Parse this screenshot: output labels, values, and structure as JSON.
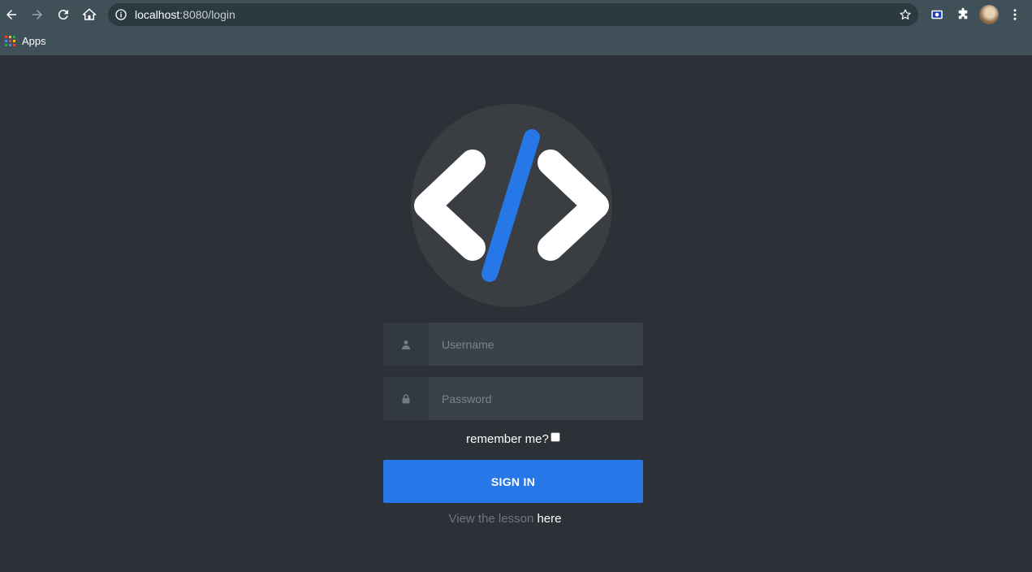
{
  "browser": {
    "url_host": "localhost",
    "url_rest": ":8080/login",
    "bookmarks": {
      "apps_label": "Apps"
    }
  },
  "login": {
    "username_placeholder": "Username",
    "password_placeholder": "Password",
    "remember_label": "remember me?",
    "signin_label": "SIGN IN",
    "lesson_text": "View the lesson",
    "lesson_link": "here"
  },
  "colors": {
    "page_bg": "#2c3138",
    "accent": "#2677e7",
    "chrome_bg": "#3f5059"
  },
  "icons": [
    "back-icon",
    "forward-icon",
    "reload-icon",
    "home-icon",
    "info-icon",
    "star-icon",
    "extension-icon",
    "puzzle-icon",
    "menu-icon",
    "user-icon",
    "lock-icon",
    "code-logo-icon"
  ]
}
